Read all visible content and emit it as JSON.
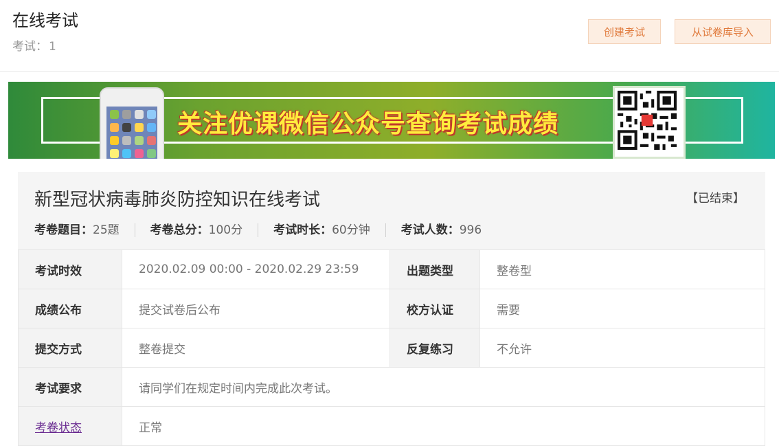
{
  "header": {
    "title": "在线考试",
    "count_label": "考试：",
    "count_value": "1",
    "create_button": "创建考试",
    "import_button": "从试卷库导入"
  },
  "banner": {
    "text": "关注优课微信公众号查询考试成绩"
  },
  "exam": {
    "title": "新型冠状病毒肺炎防控知识在线考试",
    "status": "【已结束】",
    "stats": [
      {
        "label": "考卷题目：",
        "value": "25题"
      },
      {
        "label": "考卷总分：",
        "value": "100分"
      },
      {
        "label": "考试时长：",
        "value": "60分钟"
      },
      {
        "label": "考试人数：",
        "value": "996"
      }
    ],
    "rows": [
      {
        "label": "考试时效",
        "value": "2020.02.09 00:00 - 2020.02.29 23:59",
        "label2": "出题类型",
        "value2": "整卷型"
      },
      {
        "label": "成绩公布",
        "value": "提交试卷后公布",
        "label2": "校方认证",
        "value2": "需要"
      },
      {
        "label": "提交方式",
        "value": "整卷提交",
        "label2": "反复练习",
        "value2": "不允许"
      }
    ],
    "requirement_label": "考试要求",
    "requirement_value": "请同学们在规定时间内完成此次考试。",
    "paper_status_label": "考卷状态",
    "paper_status_value": "正常"
  },
  "colors": {
    "button_bg": "#fdeee2",
    "button_text": "#e07a3c",
    "banner_text": "#ffec3d",
    "link": "#6a2c91"
  }
}
